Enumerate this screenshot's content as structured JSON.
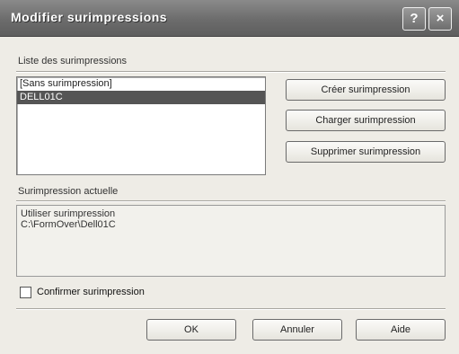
{
  "window": {
    "title": "Modifier surimpressions",
    "help_button": "?",
    "close_button": "×"
  },
  "list_section": {
    "label": "Liste des surimpressions",
    "items": [
      {
        "label": "[Sans surimpression]"
      },
      {
        "label": "DELL01C",
        "selected": true
      }
    ]
  },
  "buttons": {
    "create": "Créer surimpression",
    "load": "Charger surimpression",
    "delete": "Supprimer surimpression",
    "ok": "OK",
    "cancel": "Annuler",
    "help": "Aide"
  },
  "current_section": {
    "label": "Surimpression actuelle",
    "line1": "Utiliser surimpression",
    "line2": "C:\\FormOver\\Dell01C"
  },
  "confirm_checkbox": {
    "label": "Confirmer surimpression",
    "checked": false
  },
  "colors": {
    "titlebar": "#6c6c6c",
    "selection": "#555555",
    "dialog_bg": "#eeece6"
  }
}
